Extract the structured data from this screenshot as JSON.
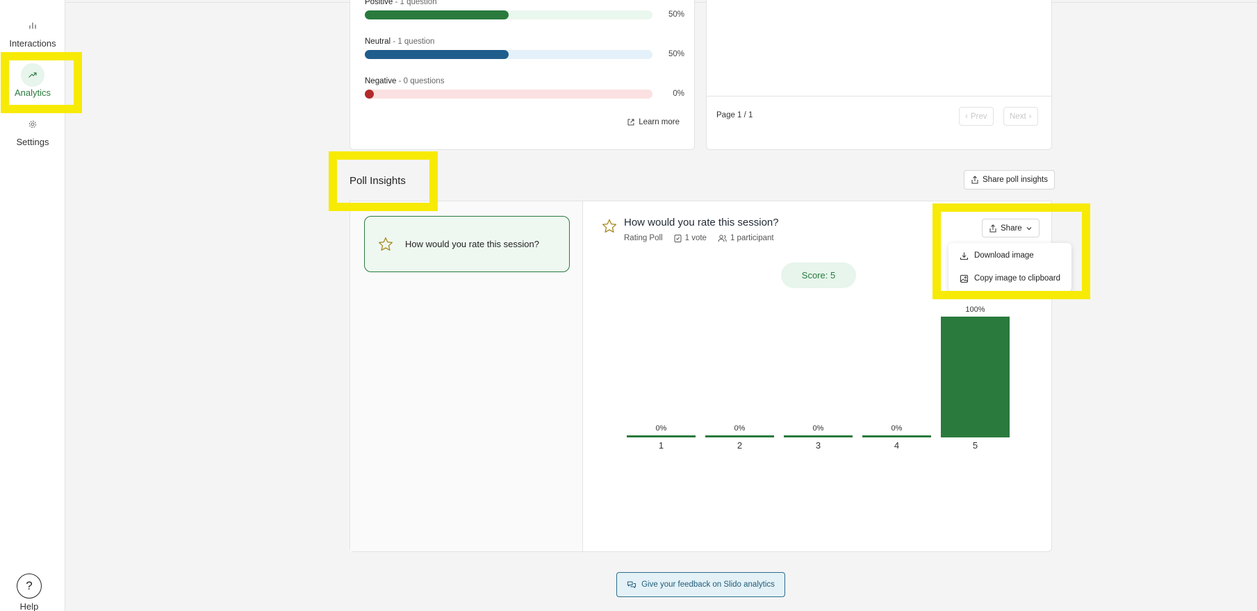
{
  "sidebar": {
    "items": [
      {
        "label": "Interactions",
        "icon": "bar-chart-icon"
      },
      {
        "label": "Analytics",
        "icon": "trending-up-icon",
        "active": true
      },
      {
        "label": "Settings",
        "icon": "gear-icon"
      }
    ],
    "help_label": "Help",
    "help_icon_glyph": "?"
  },
  "sentiment": {
    "rows": [
      {
        "name": "Positive",
        "detail": "1 question",
        "percent": 50,
        "pct_label": "50%",
        "fill": "#2a7a3d",
        "track": "#eaf7ee"
      },
      {
        "name": "Neutral",
        "detail": "1 question",
        "percent": 50,
        "pct_label": "50%",
        "fill": "#1f5d8c",
        "track": "#e4f1fa"
      },
      {
        "name": "Negative",
        "detail": "0 questions",
        "percent": 0,
        "pct_label": "0%",
        "fill": "#b22b2b",
        "track": "#fbe1e1"
      }
    ],
    "learn_more": "Learn more"
  },
  "list_panel": {
    "page_info": "Page 1 / 1",
    "prev_label": "Prev",
    "next_label": "Next"
  },
  "poll_insights": {
    "title": "Poll Insights",
    "share_all_label": "Share poll insights",
    "poll_item_text": "How would you rate this session?",
    "question": "How would you rate this session?",
    "poll_type": "Rating Poll",
    "votes": "1 vote",
    "participants": "1 participant",
    "score": "Score: 5",
    "share_label": "Share",
    "dropdown": {
      "download": "Download image",
      "copy": "Copy image to clipboard"
    }
  },
  "chart_data": {
    "type": "bar",
    "categories": [
      "1",
      "2",
      "3",
      "4",
      "5"
    ],
    "values": [
      0,
      0,
      0,
      0,
      100
    ],
    "labels": [
      "0%",
      "0%",
      "0%",
      "0%",
      "100%"
    ],
    "ylim": [
      0,
      100
    ],
    "color": "#2a7a3d"
  },
  "feedback": {
    "label": "Give your feedback on Slido analytics"
  },
  "colors": {
    "accent": "#2a7a3d",
    "highlight": "#f7ea05"
  }
}
